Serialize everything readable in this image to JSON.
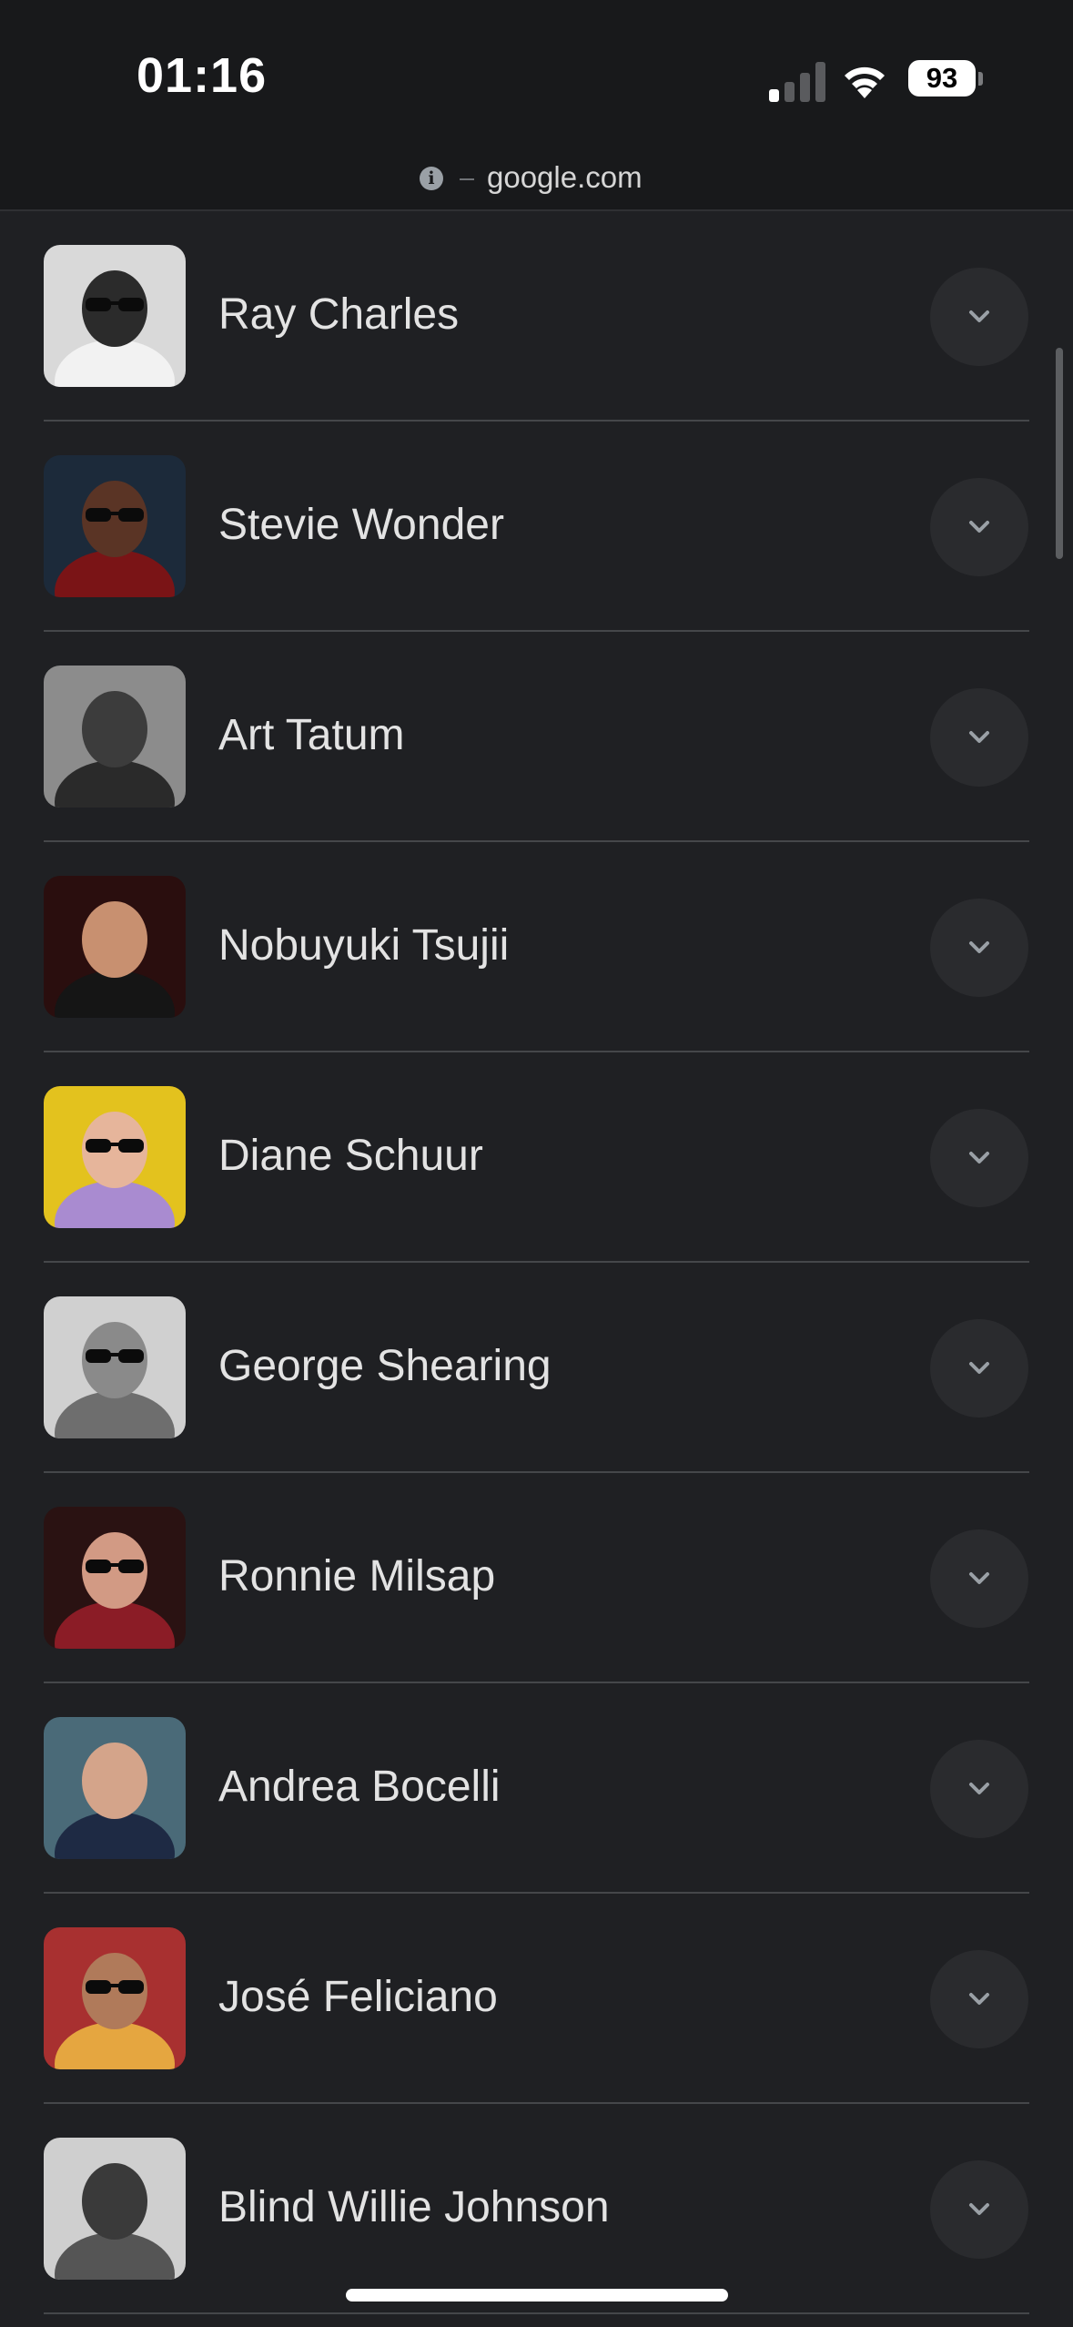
{
  "status_bar": {
    "time": "01:16",
    "battery": "93"
  },
  "url_bar": {
    "info_icon": "info-icon",
    "url": "google.com"
  },
  "results": [
    {
      "name": "Ray Charles",
      "thumb": {
        "bg": "#d9d9d9",
        "skin": "#2b2b2b",
        "shirt": "#f2f2f2",
        "glasses": true
      }
    },
    {
      "name": "Stevie Wonder",
      "thumb": {
        "bg": "#1c2a3a",
        "skin": "#5a3425",
        "shirt": "#7a1416",
        "glasses": true
      }
    },
    {
      "name": "Art Tatum",
      "thumb": {
        "bg": "#8c8c8c",
        "skin": "#3c3c3c",
        "shirt": "#2a2a2a",
        "glasses": false
      }
    },
    {
      "name": "Nobuyuki Tsujii",
      "thumb": {
        "bg": "#2a0e0e",
        "skin": "#c89070",
        "shirt": "#151515",
        "glasses": false
      }
    },
    {
      "name": "Diane Schuur",
      "thumb": {
        "bg": "#e3c21e",
        "skin": "#e6b59b",
        "shirt": "#a98bd0",
        "glasses": true
      }
    },
    {
      "name": "George Shearing",
      "thumb": {
        "bg": "#d0d0d0",
        "skin": "#8a8a8a",
        "shirt": "#6e6e6e",
        "glasses": true
      }
    },
    {
      "name": "Ronnie Milsap",
      "thumb": {
        "bg": "#2a1212",
        "skin": "#d29a84",
        "shirt": "#8b1c26",
        "glasses": true
      }
    },
    {
      "name": "Andrea Bocelli",
      "thumb": {
        "bg": "#4a6a78",
        "skin": "#d4a48a",
        "shirt": "#1e2a44",
        "glasses": false
      }
    },
    {
      "name": "José Feliciano",
      "thumb": {
        "bg": "#a83030",
        "skin": "#b07a5a",
        "shirt": "#e5a640",
        "glasses": true
      }
    },
    {
      "name": "Blind Willie Johnson",
      "thumb": {
        "bg": "#cfcfcf",
        "skin": "#3a3a3a",
        "shirt": "#555555",
        "glasses": false
      }
    }
  ],
  "colors": {
    "background": "#1f2023",
    "divider": "#45474a",
    "expand_button": "#2a2b2e",
    "chevron": "#9aa0a6"
  }
}
